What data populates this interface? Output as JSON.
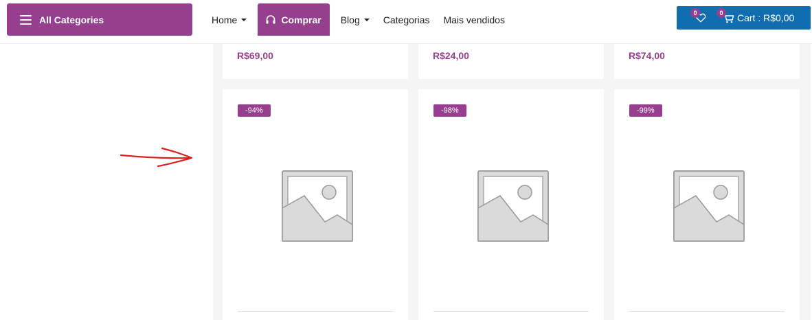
{
  "header": {
    "all_categories": "All Categories",
    "nav": [
      {
        "label": "Home",
        "has_dropdown": true
      },
      {
        "label": "Comprar",
        "icon": "headset-icon",
        "active": true
      },
      {
        "label": "Blog",
        "has_dropdown": true
      },
      {
        "label": "Categorias"
      },
      {
        "label": "Mais vendidos"
      }
    ],
    "wishlist_count": "0",
    "cart_count": "0",
    "cart_label": "Cart : R$0,00"
  },
  "products_top": [
    {
      "price": "R$69,00"
    },
    {
      "price": "R$24,00"
    },
    {
      "price": "R$74,00"
    }
  ],
  "products": [
    {
      "discount": "-94%",
      "image": "placeholder-image-icon"
    },
    {
      "discount": "-98%",
      "image": "placeholder-image-icon"
    },
    {
      "discount": "-99%",
      "image": "placeholder-image-icon"
    }
  ],
  "annotation": {
    "icon": "red-arrow-annotation"
  },
  "colors": {
    "brand": "#963f8e",
    "cart": "#0f6db0",
    "annotation": "#e02020"
  }
}
